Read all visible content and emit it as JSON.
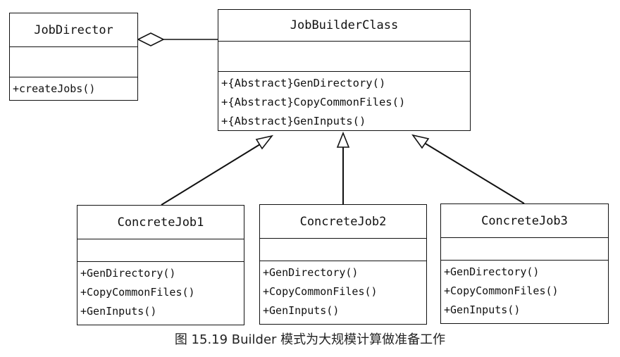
{
  "director": {
    "name": "JobDirector",
    "operations": [
      "+createJobs()"
    ]
  },
  "builder": {
    "name": "JobBuilderClass",
    "operations": [
      "+{Abstract}GenDirectory()",
      "+{Abstract}CopyCommonFiles()",
      "+{Abstract}GenInputs()"
    ]
  },
  "jobs": [
    {
      "name": "ConcreteJob1",
      "operations": [
        "+GenDirectory()",
        "+CopyCommonFiles()",
        "+GenInputs()"
      ]
    },
    {
      "name": "ConcreteJob2",
      "operations": [
        "+GenDirectory()",
        "+CopyCommonFiles()",
        "+GenInputs()"
      ]
    },
    {
      "name": "ConcreteJob3",
      "operations": [
        "+GenDirectory()",
        "+CopyCommonFiles()",
        "+GenInputs()"
      ]
    }
  ],
  "relations": {
    "aggregation": {
      "from": "JobDirector",
      "to": "JobBuilderClass",
      "type": "aggregation"
    },
    "generalizations": [
      {
        "from": "ConcreteJob1",
        "to": "JobBuilderClass",
        "type": "inheritance"
      },
      {
        "from": "ConcreteJob2",
        "to": "JobBuilderClass",
        "type": "inheritance"
      },
      {
        "from": "ConcreteJob3",
        "to": "JobBuilderClass",
        "type": "inheritance"
      }
    ]
  },
  "caption": "图 15.19    Builder 模式为大规模计算做准备工作"
}
